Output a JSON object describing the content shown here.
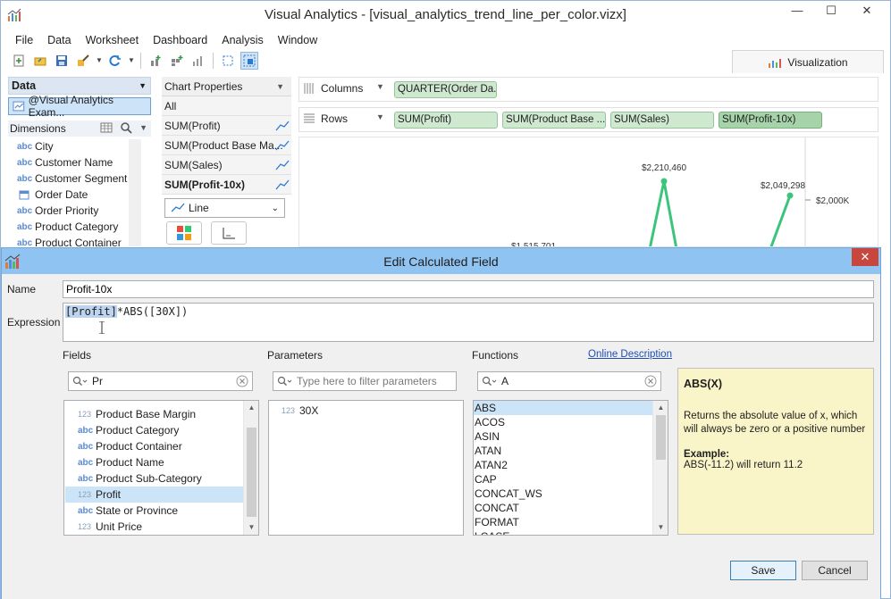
{
  "window": {
    "title": "Visual Analytics - [visual_analytics_trend_line_per_color.vizx]",
    "minimize": "—",
    "maximize": "☐",
    "close": "✕"
  },
  "menu": [
    "File",
    "Data",
    "Worksheet",
    "Dashboard",
    "Analysis",
    "Window"
  ],
  "visualization_tab": "Visualization",
  "data_panel": {
    "header": "Data",
    "datasource": "@Visual Analytics Exam...",
    "dimensions_header": "Dimensions",
    "dimensions": [
      "City",
      "Customer Name",
      "Customer Segment",
      "Order Date",
      "Order Priority",
      "Product Category",
      "Product Container"
    ]
  },
  "chart_properties": {
    "header": "Chart Properties",
    "rows": [
      "All",
      "SUM(Profit)",
      "SUM(Product Base Ma...",
      "SUM(Sales)",
      "SUM(Profit-10x)"
    ],
    "mark_type": "Line"
  },
  "shelves": {
    "columns_label": "Columns",
    "columns": [
      "QUARTER(Order Da..."
    ],
    "rows_label": "Rows",
    "rows": [
      "SUM(Profit)",
      "SUM(Product Base ...",
      "SUM(Sales)",
      "SUM(Profit-10x)"
    ]
  },
  "chart_data": {
    "type": "line",
    "title": "",
    "xlabel": "",
    "ylabel": "",
    "data_labels": [
      "$2,210,460",
      "$2,049,298",
      "$1,515,701"
    ],
    "y_tick_labels": [
      "$2,000K"
    ],
    "series": [
      {
        "color": "#3cc47c",
        "points": [
          {
            "label": "$1,515,701",
            "y": 1515701
          },
          {
            "label": "$2,210,460",
            "y": 2210460
          },
          {
            "label": "$2,049,298",
            "y": 2049298
          }
        ]
      }
    ]
  },
  "dialog": {
    "title": "Edit Calculated Field",
    "close": "✕",
    "name_label": "Name",
    "name_value": "Profit-10x",
    "expression_label": "Expression",
    "expression_highlight": "[Profit]",
    "expression_rest": "*ABS([30X])",
    "fields_label": "Fields",
    "fields_search": "Pr",
    "fields": [
      {
        "type": "123",
        "name": "Product Base Margin",
        "selected": false
      },
      {
        "type": "abc",
        "name": "Product Category",
        "selected": false
      },
      {
        "type": "abc",
        "name": "Product Container",
        "selected": false
      },
      {
        "type": "abc",
        "name": "Product Name",
        "selected": false
      },
      {
        "type": "abc",
        "name": "Product Sub-Category",
        "selected": false
      },
      {
        "type": "123",
        "name": "Profit",
        "selected": true
      },
      {
        "type": "abc",
        "name": "State or Province",
        "selected": false
      },
      {
        "type": "123",
        "name": "Unit Price",
        "selected": false
      }
    ],
    "parameters_label": "Parameters",
    "parameters_placeholder": "Type here to filter parameters",
    "parameters": [
      {
        "type": "123",
        "name": "30X"
      }
    ],
    "functions_label": "Functions",
    "online_description": "Online Description",
    "functions_search": "A",
    "functions": [
      "ABS",
      "ACOS",
      "ASIN",
      "ATAN",
      "ATAN2",
      "CAP",
      "CONCAT_WS",
      "CONCAT",
      "FORMAT",
      "LCASE"
    ],
    "selected_function": "ABS",
    "info": {
      "title": "ABS(X)",
      "description": "Returns the absolute value of x, which will always be zero or a positive number",
      "example_label": "Example:",
      "example": "ABS(-11.2) will return 11.2"
    },
    "save": "Save",
    "cancel": "Cancel"
  },
  "colors": {
    "accent": "#8fc3f1",
    "pill": "#cfe8d0",
    "line": "#3cc47c",
    "info_bg": "#faf5c8",
    "close_red": "#c7463d"
  }
}
